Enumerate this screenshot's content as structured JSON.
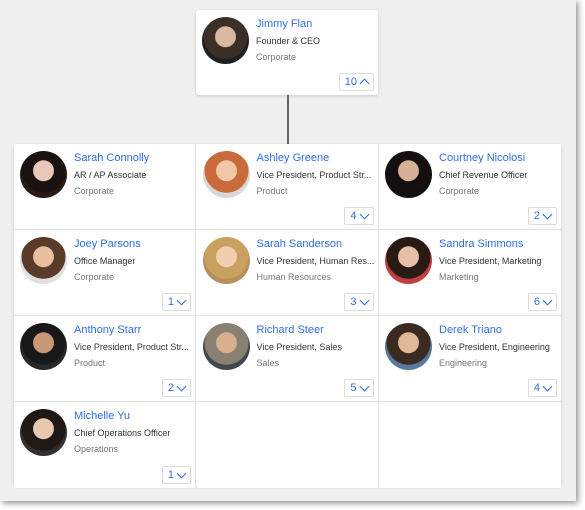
{
  "root": {
    "name": "Jimmy Flan",
    "title": "Founder & CEO",
    "department": "Corporate",
    "count": "10",
    "expanded": true,
    "avatar_colors": [
      "#3a3028",
      "#d9b8a0",
      "#202020"
    ]
  },
  "reports": [
    {
      "name": "Sarah Connolly",
      "title": "AR / AP Associate",
      "department": "Corporate",
      "count": null,
      "avatar_colors": [
        "#1a1210",
        "#e8c8b8",
        "#2a1a14"
      ]
    },
    {
      "name": "Ashley Greene",
      "title": "Vice President, Product Str...",
      "department": "Product",
      "count": "4",
      "avatar_colors": [
        "#c86a3a",
        "#f0c8a8",
        "#d8d8d8"
      ]
    },
    {
      "name": "Courtney Nicolosi",
      "title": "Chief Revenue Officer",
      "department": "Corporate",
      "count": "2",
      "avatar_colors": [
        "#141010",
        "#d8b098",
        "#101010"
      ]
    },
    {
      "name": "Joey Parsons",
      "title": "Office Manager",
      "department": "Corporate",
      "count": "1",
      "avatar_colors": [
        "#5a3a28",
        "#e8c0a0",
        "#e0e0e0"
      ]
    },
    {
      "name": "Sarah Sanderson",
      "title": "Vice President, Human Res...",
      "department": "Human Resources",
      "count": "3",
      "avatar_colors": [
        "#c8a060",
        "#f0d0b0",
        "#b89060"
      ]
    },
    {
      "name": "Sandra Simmons",
      "title": "Vice President, Marketing",
      "department": "Marketing",
      "count": "6",
      "avatar_colors": [
        "#2a1a14",
        "#e8c0a8",
        "#c04040"
      ]
    },
    {
      "name": "Anthony Starr",
      "title": "Vice President, Product Str...",
      "department": "Product",
      "count": "2",
      "avatar_colors": [
        "#181818",
        "#c89878",
        "#282828"
      ]
    },
    {
      "name": "Richard Steer",
      "title": "Vice President, Sales",
      "department": "Sales",
      "count": "5",
      "avatar_colors": [
        "#888070",
        "#d8b090",
        "#404850"
      ]
    },
    {
      "name": "Derek Triano",
      "title": "Vice President, Engineering",
      "department": "Engineering",
      "count": "4",
      "avatar_colors": [
        "#3a2a20",
        "#e0b898",
        "#5878a0"
      ]
    },
    {
      "name": "Michelle Yu",
      "title": "Chief Operations Officer",
      "department": "Operations",
      "count": "1",
      "avatar_colors": [
        "#201814",
        "#e8c8b0",
        "#303030"
      ]
    }
  ],
  "accent_color": "#2f6fe0"
}
